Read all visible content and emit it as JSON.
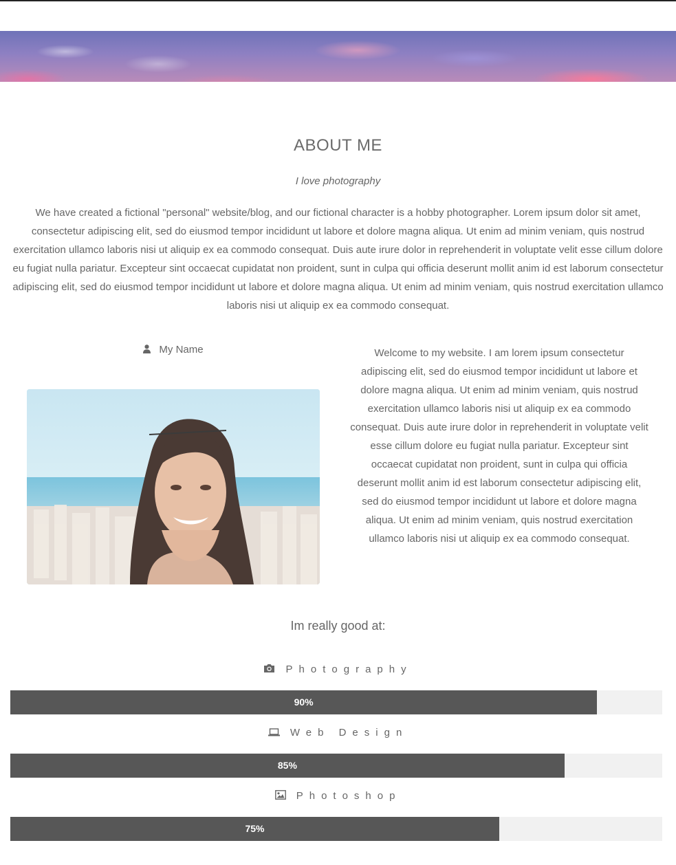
{
  "page": {
    "title": "ABOUT ME",
    "subtitle": "I love photography",
    "intro": "We have created a fictional \"personal\" website/blog, and our fictional character is a hobby photographer. Lorem ipsum dolor sit amet, consectetur adipiscing elit, sed do eiusmod tempor incididunt ut labore et dolore magna aliqua. Ut enim ad minim veniam, quis nostrud exercitation ullamco laboris nisi ut aliquip ex ea commodo consequat. Duis aute irure dolor in reprehenderit in voluptate velit esse cillum dolore eu fugiat nulla pariatur. Excepteur sint occaecat cupidatat non proident, sunt in culpa qui officia deserunt mollit anim id est laborum consectetur adipiscing elit, sed do eiusmod tempor incididunt ut labore et dolore magna aliqua. Ut enim ad minim veniam, quis nostrud exercitation ullamco laboris nisi ut aliquip ex ea commodo consequat."
  },
  "profile": {
    "name": "My Name",
    "name_icon": "user-icon",
    "welcome": "Welcome to my website. I am lorem ipsum consectetur adipiscing elit, sed do eiusmod tempor incididunt ut labore et dolore magna aliqua. Ut enim ad minim veniam, quis nostrud exercitation ullamco laboris nisi ut aliquip ex ea commodo consequat. Duis aute irure dolor in reprehenderit in voluptate velit esse cillum dolore eu fugiat nulla pariatur. Excepteur sint occaecat cupidatat non proident, sunt in culpa qui officia deserunt mollit anim id est laborum consectetur adipiscing elit, sed do eiusmod tempor incididunt ut labore et dolore magna aliqua. Ut enim ad minim veniam, quis nostrud exercitation ullamco laboris nisi ut aliquip ex ea commodo consequat."
  },
  "skills": {
    "heading": "Im really good at:",
    "items": [
      {
        "label": "Photography",
        "icon": "camera-icon",
        "percent": 90,
        "percent_label": "90%"
      },
      {
        "label": "Web Design",
        "icon": "laptop-icon",
        "percent": 85,
        "percent_label": "85%"
      },
      {
        "label": "Photoshop",
        "icon": "image-icon",
        "percent": 75,
        "percent_label": "75%"
      }
    ]
  },
  "colors": {
    "bar_fill": "#575757",
    "bar_track": "#f1f1f1",
    "text": "#666666"
  }
}
